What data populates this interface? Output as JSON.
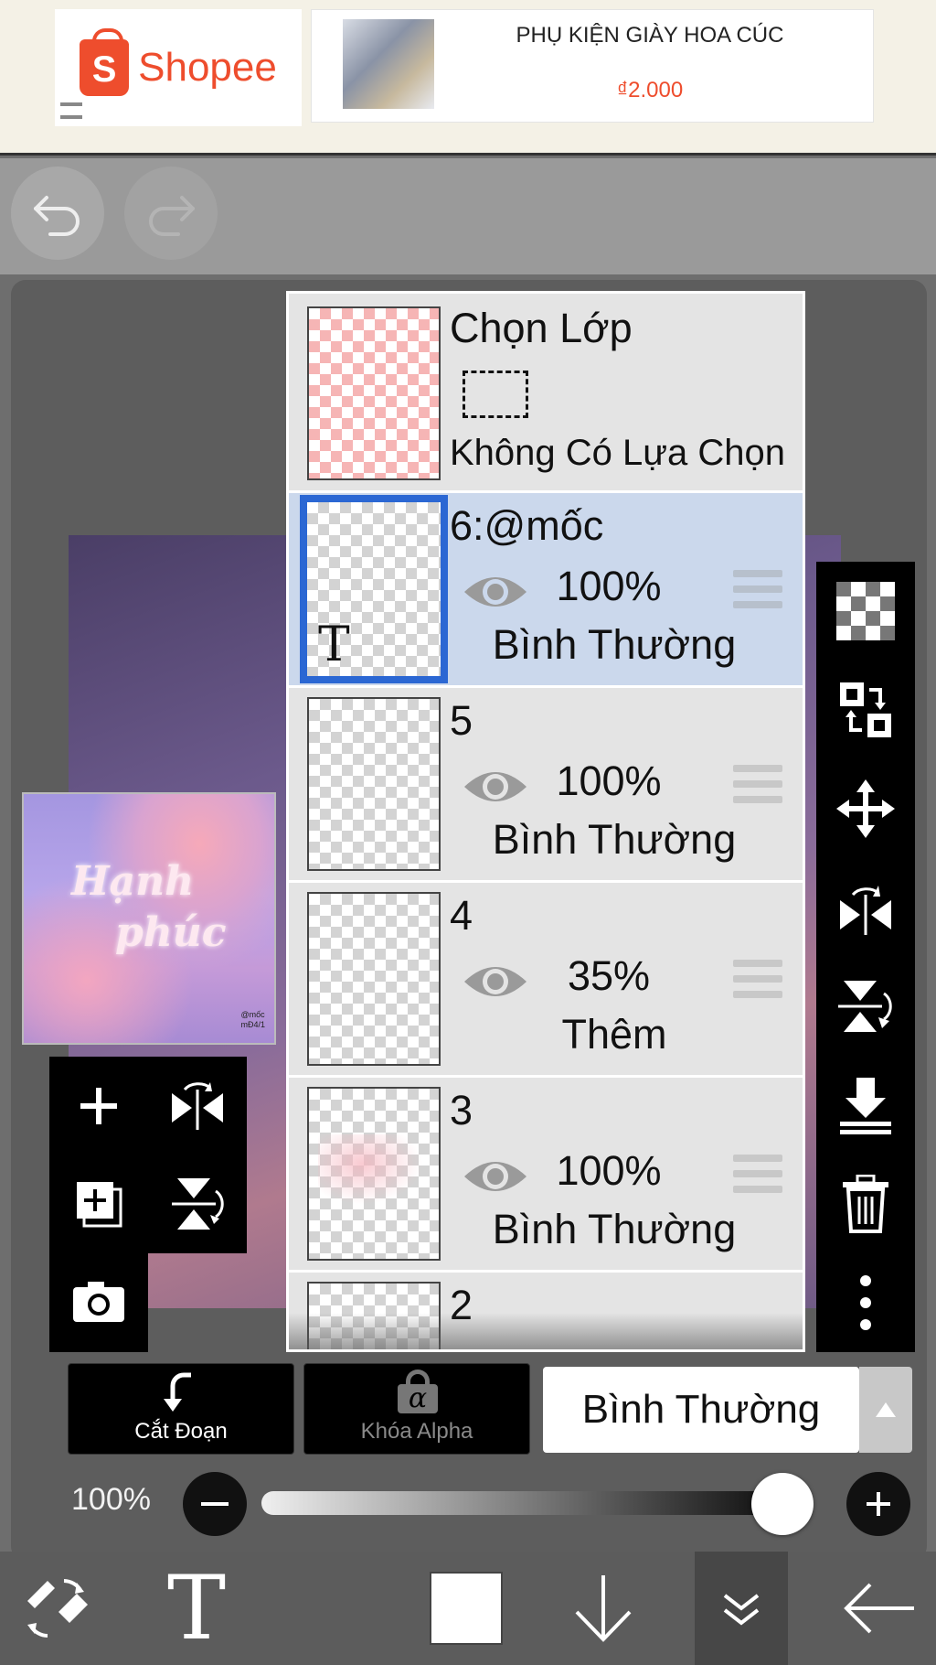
{
  "ad": {
    "brand": "Shopee",
    "brand_initial": "S",
    "product_title": "PHỤ KIỆN GIÀY HOA CÚC",
    "price": "₫2.000",
    "brand_color": "#ee4d2d"
  },
  "history": {
    "undo_icon": "undo-icon",
    "redo_icon": "redo-icon"
  },
  "preview": {
    "line1": "Hạnh",
    "line2": "phúc",
    "signature_line1": "@mốc",
    "signature_line2": "mĐ4/1"
  },
  "layer_panel": {
    "selection_layer": {
      "title": "Chọn Lớp",
      "status": "Không Có Lựa Chọn"
    },
    "layers": [
      {
        "name": "6:@mốc",
        "opacity": "100%",
        "blend": "Bình Thường",
        "selected": true,
        "type": "text",
        "type_glyph": "T"
      },
      {
        "name": "5",
        "opacity": "100%",
        "blend": "Bình Thường",
        "selected": false
      },
      {
        "name": "4",
        "opacity": "35%",
        "blend": "Thêm",
        "selected": false
      },
      {
        "name": "3",
        "opacity": "100%",
        "blend": "Bình Thường",
        "selected": false
      },
      {
        "name": "2"
      }
    ],
    "selected_color": "#cbd8ec",
    "accent_color": "#2b67d3"
  },
  "left_tools": [
    "add-layer-icon",
    "flip-horizontal-icon",
    "add-copy-layer-icon",
    "flip-vertical-icon",
    "camera-icon"
  ],
  "right_tools": [
    "transparency-icon",
    "swap-layer-icon",
    "move-icon",
    "flip-horizontal-icon",
    "flip-vertical-icon",
    "merge-down-icon",
    "trash-icon",
    "more-icon"
  ],
  "bottom_controls": {
    "clip_label": "Cắt Đoạn",
    "alpha_lock_label": "Khóa Alpha",
    "alpha_glyph": "α",
    "blend_mode": "Bình Thường",
    "opacity_label": "100%",
    "opacity_value": 1.0
  },
  "bottom_toolbar": [
    "select-tool-icon",
    "text-tool-icon",
    "color-swatch",
    "download-icon",
    "layers-collapse-icon",
    "back-arrow-icon"
  ],
  "bottom_toolbar_text_glyph": "T"
}
